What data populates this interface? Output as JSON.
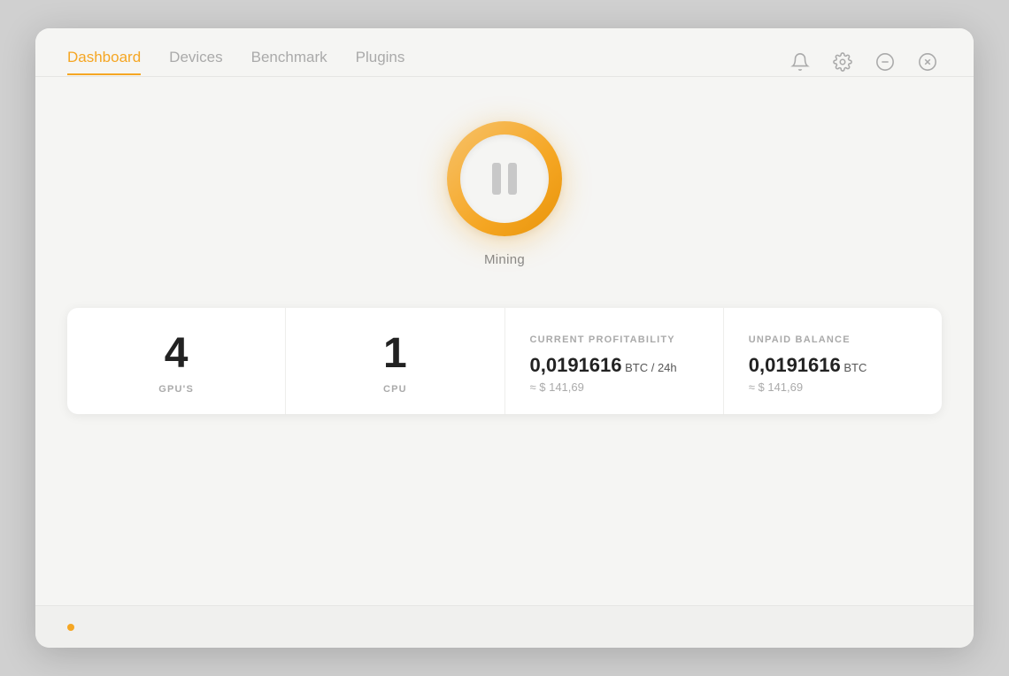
{
  "nav": {
    "tabs": [
      {
        "id": "dashboard",
        "label": "Dashboard",
        "active": true
      },
      {
        "id": "devices",
        "label": "Devices",
        "active": false
      },
      {
        "id": "benchmark",
        "label": "Benchmark",
        "active": false
      },
      {
        "id": "plugins",
        "label": "Plugins",
        "active": false
      }
    ],
    "actions": [
      {
        "id": "notifications",
        "icon": "bell"
      },
      {
        "id": "settings",
        "icon": "gear"
      },
      {
        "id": "minimize",
        "icon": "minus"
      },
      {
        "id": "close",
        "icon": "x-circle"
      }
    ]
  },
  "mining": {
    "status_label": "Mining",
    "button_state": "paused"
  },
  "stats": [
    {
      "id": "gpus",
      "value": "4",
      "label": "GPU'S"
    },
    {
      "id": "cpu",
      "value": "1",
      "label": "CPU"
    },
    {
      "id": "profitability",
      "section_label": "CURRENT PROFITABILITY",
      "main_value": "0,0191616",
      "main_unit": " BTC / 24h",
      "sub_value": "≈ $ 141,69"
    },
    {
      "id": "balance",
      "section_label": "UNPAID BALANCE",
      "main_value": "0,0191616",
      "main_unit": " BTC",
      "sub_value": "≈ $ 141,69"
    }
  ],
  "colors": {
    "accent": "#f5a623",
    "text_primary": "#222",
    "text_secondary": "#aaa",
    "border": "#eeeeec",
    "bg": "#f5f5f3"
  }
}
